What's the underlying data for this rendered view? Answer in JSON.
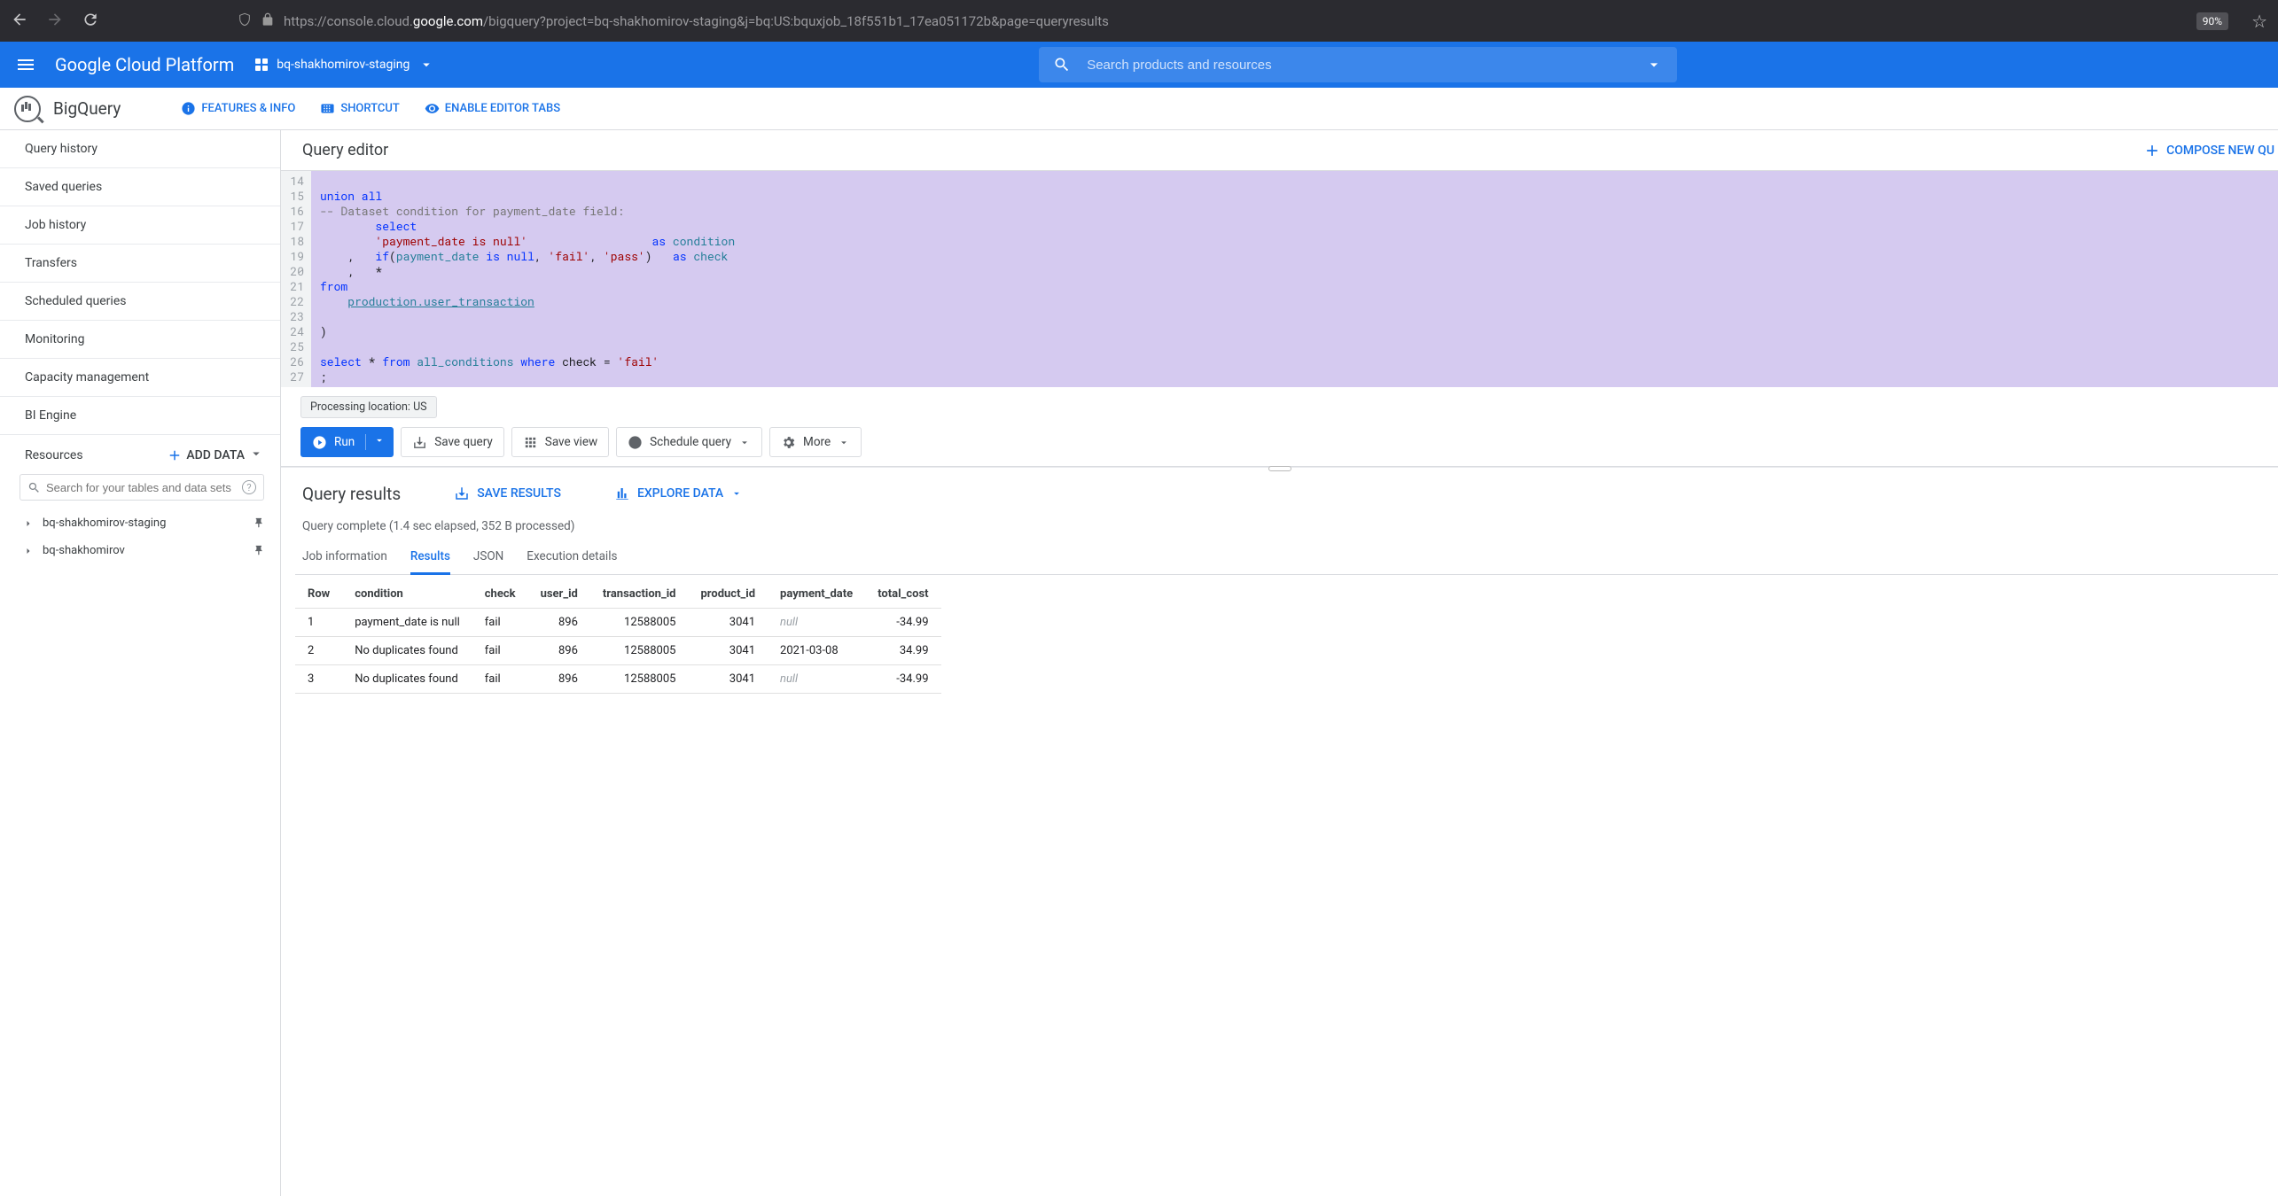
{
  "browser": {
    "url_pre": "https://console.cloud.",
    "url_dom": "google.com",
    "url_post": "/bigquery?project=bq-shakhomirov-staging&j=bq:US:bquxjob_18f551b1_17ea051172b&page=queryresults",
    "zoom": "90%"
  },
  "header": {
    "logo": "Google Cloud Platform",
    "project": "bq-shakhomirov-staging",
    "search_placeholder": "Search products and resources"
  },
  "subheader": {
    "bq": "BigQuery",
    "features": "FEATURES & INFO",
    "shortcut": "SHORTCUT",
    "tabs": "ENABLE EDITOR TABS"
  },
  "sidebar": {
    "nav": [
      "Query history",
      "Saved queries",
      "Job history",
      "Transfers",
      "Scheduled queries",
      "Monitoring",
      "Capacity management",
      "BI Engine"
    ],
    "resources": "Resources",
    "add_data": "ADD DATA",
    "search_placeholder": "Search for your tables and data sets",
    "projects": [
      "bq-shakhomirov-staging",
      "bq-shakhomirov"
    ]
  },
  "editor": {
    "title": "Query editor",
    "compose": "COMPOSE NEW QU",
    "lines": [
      {
        "n": "14",
        "t": ""
      },
      {
        "n": "15",
        "t": "<span class='kw'>union all</span>"
      },
      {
        "n": "16",
        "t": "<span class='cm'>-- Dataset condition for payment_date field:</span>"
      },
      {
        "n": "17",
        "t": "        <span class='kw'>select</span>"
      },
      {
        "n": "18",
        "t": "        <span class='str'>'payment_date is null'</span>                  <span class='kw'>as</span> <span class='fn'>condition</span>"
      },
      {
        "n": "19",
        "t": "    ,   <span class='kw'>if</span>(<span class='fn'>payment_date</span> <span class='kw'>is null</span>, <span class='str'>'fail'</span>, <span class='str'>'pass'</span>)   <span class='kw'>as</span> <span class='fn'>check</span>"
      },
      {
        "n": "20",
        "t": "    ,   *"
      },
      {
        "n": "21",
        "t": "<span class='kw'>from</span>"
      },
      {
        "n": "22",
        "t": "    <span class='fn tbl'>production.user_transaction</span>"
      },
      {
        "n": "23",
        "t": ""
      },
      {
        "n": "24",
        "t": ")"
      },
      {
        "n": "25",
        "t": ""
      },
      {
        "n": "26",
        "t": "<span class='kw'>select</span> * <span class='kw'>from</span> <span class='fn'>all_conditions</span> <span class='kw'>where</span> check = <span class='str'>'fail'</span>"
      },
      {
        "n": "27",
        "t": ";"
      }
    ],
    "processing": "Processing location: US",
    "run": "Run",
    "save_query": "Save query",
    "save_view": "Save view",
    "schedule": "Schedule query",
    "more": "More"
  },
  "results": {
    "title": "Query results",
    "save_results": "SAVE RESULTS",
    "explore": "EXPLORE DATA",
    "status": "Query complete (1.4 sec elapsed, 352 B processed)",
    "tabs": [
      "Job information",
      "Results",
      "JSON",
      "Execution details"
    ],
    "active_tab": 1,
    "columns": [
      "Row",
      "condition",
      "check",
      "user_id",
      "transaction_id",
      "product_id",
      "payment_date",
      "total_cost"
    ],
    "rows": [
      {
        "Row": "1",
        "condition": "payment_date is null",
        "check": "fail",
        "user_id": "896",
        "transaction_id": "12588005",
        "product_id": "3041",
        "payment_date": "null",
        "total_cost": "-34.99"
      },
      {
        "Row": "2",
        "condition": "No duplicates found",
        "check": "fail",
        "user_id": "896",
        "transaction_id": "12588005",
        "product_id": "3041",
        "payment_date": "2021-03-08",
        "total_cost": "34.99"
      },
      {
        "Row": "3",
        "condition": "No duplicates found",
        "check": "fail",
        "user_id": "896",
        "transaction_id": "12588005",
        "product_id": "3041",
        "payment_date": "null",
        "total_cost": "-34.99"
      }
    ]
  }
}
